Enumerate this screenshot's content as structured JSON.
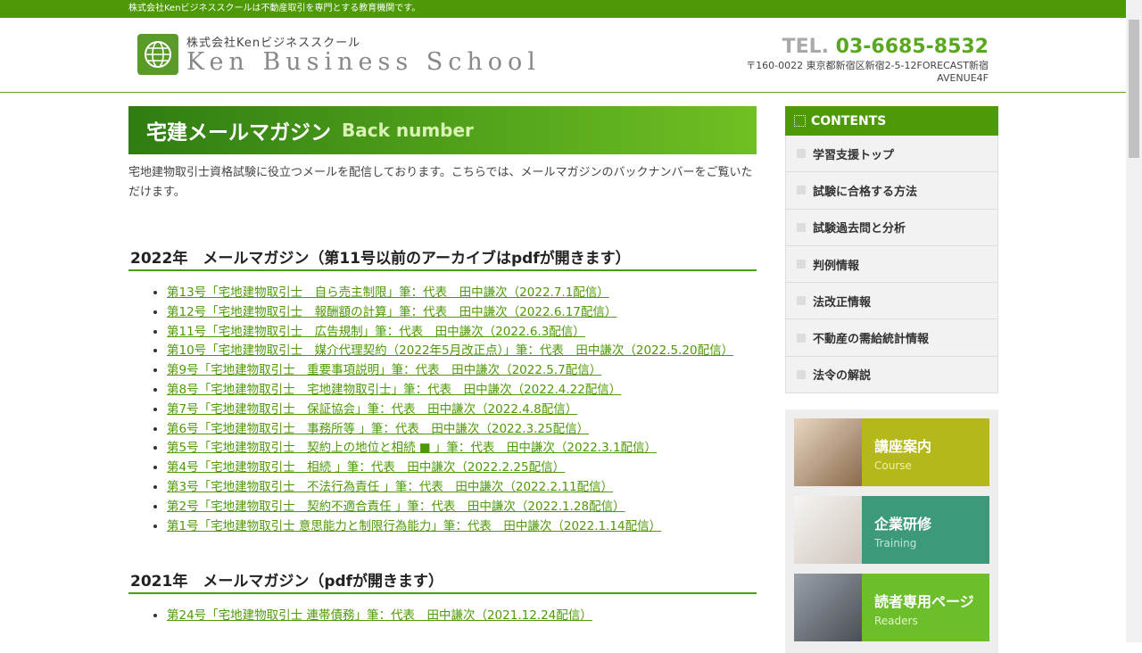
{
  "topbar": {
    "text": "株式会社Kenビジネススクールは不動産取引を専門とする教育機関です。"
  },
  "header": {
    "logo_jp": "株式会社Kenビジネススクール",
    "logo_en": "Ken Business School",
    "tel_label": "TEL.",
    "tel_number": "03-6685-8532",
    "address": "〒160-0022 東京都新宿区新宿2-5-12FORECAST新宿AVENUE4F"
  },
  "main": {
    "title_jp": "宅建メールマガジン",
    "title_en": "Back number",
    "intro": "宅地建物取引士資格試験に役立つメールを配信しております。こちらでは、メールマガジンのバックナンバーをご覧いただけます。",
    "year2022": {
      "heading": "2022年　メールマガジン（第11号以前のアーカイブはpdfが開きます）",
      "items": [
        "第13号「宅地建物取引士　自ら売主制限」筆：代表　田中謙次（2022.7.1配信）",
        "第12号「宅地建物取引士　報酬額の計算」筆：代表　田中謙次（2022.6.17配信）",
        "第11号「宅地建物取引士　広告規制」筆：代表　田中謙次（2022.6.3配信）",
        "第10号「宅地建物取引士　媒介代理契約（2022年5月改正点）」筆：代表　田中謙次（2022.5.20配信）",
        "第9号「宅地建物取引士　重要事項説明」筆：代表　田中謙次（2022.5.7配信）",
        "第8号「宅地建物取引士　宅地建物取引士」筆：代表　田中謙次（2022.4.22配信）",
        "第7号「宅地建物取引士　保証協会」筆：代表　田中謙次（2022.4.8配信）",
        "第6号「宅地建物取引士　事務所等 」筆：代表　田中謙次（2022.3.25配信）",
        "第5号「宅地建物取引士　契約上の地位と相続 ■ 」筆：代表　田中謙次（2022.3.1配信）",
        "第4号「宅地建物取引士　相続 」筆：代表　田中謙次（2022.2.25配信）",
        "第3号「宅地建物取引士　不法行為責任 」筆：代表　田中謙次（2022.2.11配信）",
        "第2号「宅地建物取引士　契約不適合責任 」筆：代表　田中謙次（2022.1.28配信）",
        "第1号「宅地建物取引士 意思能力と制限行為能力」筆：代表　田中謙次（2022.1.14配信）"
      ]
    },
    "year2021": {
      "heading": "2021年　メールマガジン（pdfが開きます）",
      "items": [
        "第24号「宅地建物取引士 連帯債務」筆：代表　田中謙次（2021.12.24配信）"
      ]
    }
  },
  "sidebar": {
    "contents_label": "CONTENTS",
    "items": [
      "学習支援トップ",
      "試験に合格する方法",
      "試験過去問と分析",
      "判例情報",
      "法改正情報",
      "不動産の需給統計情報",
      "法令の解説"
    ],
    "banners": [
      {
        "title": "講座案内",
        "sub": "Course",
        "color": "#b5b81a"
      },
      {
        "title": "企業研修",
        "sub": "Training",
        "color": "#3c9a7a"
      },
      {
        "title": "読者専用ページ",
        "sub": "Readers",
        "color": "#6cbf2a"
      }
    ]
  }
}
